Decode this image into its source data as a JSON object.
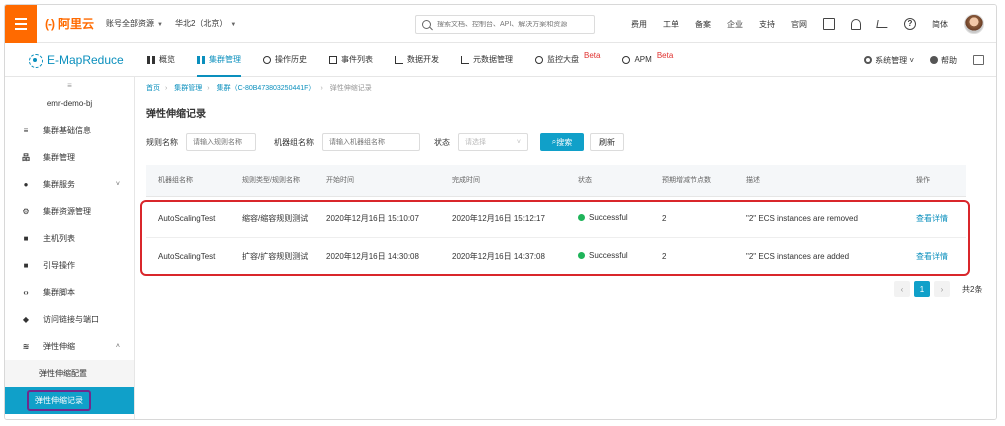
{
  "topbar": {
    "logo_glyph": "(-)",
    "logo_text": "阿里云",
    "account": "账号全部资源",
    "region": "华北2（北京）",
    "search_placeholder": "搜索文档、控制台、API、解决方案和资源",
    "links": [
      "费用",
      "工单",
      "备案",
      "企业",
      "支持",
      "官网"
    ],
    "lang": "简体"
  },
  "secbar": {
    "brand": "E-MapReduce",
    "tabs": [
      {
        "label": "概览",
        "beta": ""
      },
      {
        "label": "集群管理",
        "beta": ""
      },
      {
        "label": "操作历史",
        "beta": ""
      },
      {
        "label": "事件列表",
        "beta": ""
      },
      {
        "label": "数据开发",
        "beta": ""
      },
      {
        "label": "元数据管理",
        "beta": ""
      },
      {
        "label": "监控大盘",
        "beta": "Beta"
      },
      {
        "label": "APM",
        "beta": "Beta"
      }
    ],
    "sys_manage": "系统管理",
    "help": "帮助"
  },
  "sidebar": {
    "collapse_symbol": "≡",
    "cluster_name": "emr-demo-bj",
    "items": [
      {
        "label": "集群基础信息",
        "icon": "≡"
      },
      {
        "label": "集群管理",
        "icon": "品"
      },
      {
        "label": "集群服务",
        "icon": "●"
      },
      {
        "label": "集群资源管理",
        "icon": "⚙"
      },
      {
        "label": "主机列表",
        "icon": "■"
      },
      {
        "label": "引导操作",
        "icon": "■"
      },
      {
        "label": "集群脚本",
        "icon": "‹›"
      },
      {
        "label": "访问链接与端口",
        "icon": "◆"
      },
      {
        "label": "弹性伸缩",
        "icon": "≋"
      }
    ],
    "sub_items": [
      "弹性伸缩配置",
      "弹性伸缩记录"
    ]
  },
  "breadcrumb": [
    "首页",
    "集群管理",
    "集群（C-80B473803250441F）",
    "弹性伸缩记录"
  ],
  "page_title": "弹性伸缩记录",
  "filters": {
    "rule_name_label": "规则名称",
    "rule_name_placeholder": "请输入规则名称",
    "group_name_label": "机器组名称",
    "group_name_placeholder": "请输入机器组名称",
    "status_label": "状态",
    "status_placeholder": "请选择",
    "search_button": "搜索",
    "reset_button": "刷新"
  },
  "table": {
    "headers": [
      "机器组名称",
      "规则类型/规则名称",
      "开始时间",
      "完成时间",
      "状态",
      "预期增减节点数",
      "描述",
      "操作"
    ],
    "rows": [
      {
        "group": "AutoScalingTest",
        "rule": "缩容/缩容规则测试",
        "start": "2020年12月16日 15:10:07",
        "end": "2020年12月16日 15:12:17",
        "status": "Successful",
        "delta": "2",
        "desc": "\"2\" ECS instances are removed",
        "action": "查看详情"
      },
      {
        "group": "AutoScalingTest",
        "rule": "扩容/扩容规则测试",
        "start": "2020年12月16日 14:30:08",
        "end": "2020年12月16日 14:37:08",
        "status": "Successful",
        "delta": "2",
        "desc": "\"2\" ECS instances are added",
        "action": "查看详情"
      }
    ]
  },
  "pager": {
    "prev": "‹",
    "current": "1",
    "next": "›",
    "total": "共2条"
  },
  "colors": {
    "brand_orange": "#ff6a00",
    "accent_blue": "#10a0c9",
    "success_green": "#1fb45a",
    "highlight_red": "#d9262b",
    "highlight_purple": "#6f2a8d"
  }
}
